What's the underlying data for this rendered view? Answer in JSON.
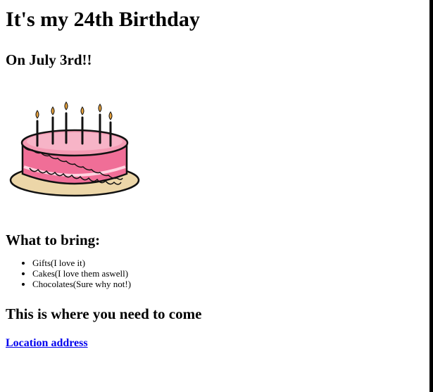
{
  "title": "It's my 24th Birthday",
  "subtitle": "On July 3rd!!",
  "image": {
    "icon": "birthday-cake-icon",
    "colors": {
      "frosting": "#f49ab3",
      "cake_body": "#f06e97",
      "plate": "#ecd6a8",
      "flame": "#e8a23c"
    }
  },
  "bring": {
    "heading": "What to bring:",
    "items": [
      "Gifts(I love it)",
      "Cakes(I love them aswell)",
      "Chocolates(Sure why not!)"
    ]
  },
  "location": {
    "heading": "This is where you need to come",
    "link_text": "Location address",
    "link_color": "#0000ee"
  }
}
